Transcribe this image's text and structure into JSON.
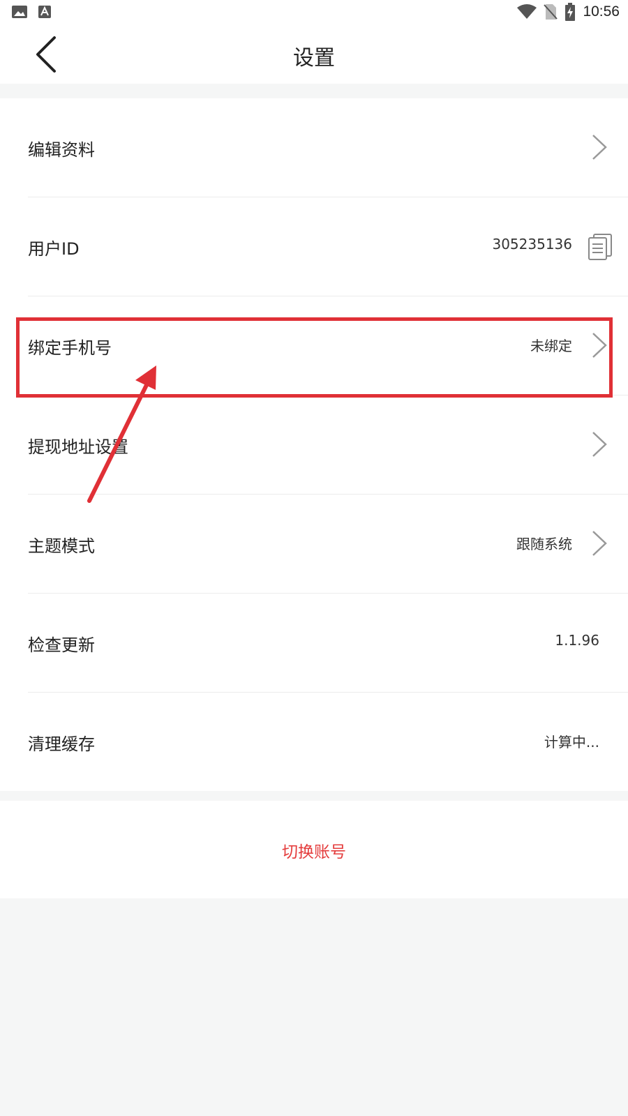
{
  "status_bar": {
    "time": "10:56"
  },
  "header": {
    "title": "设置"
  },
  "settings": {
    "edit_profile": {
      "label": "编辑资料"
    },
    "user_id": {
      "label": "用户ID",
      "value": "305235136"
    },
    "bind_phone": {
      "label": "绑定手机号",
      "value": "未绑定"
    },
    "withdraw_address": {
      "label": "提现地址设置"
    },
    "theme_mode": {
      "label": "主题模式",
      "value": "跟随系统"
    },
    "check_update": {
      "label": "检查更新",
      "value": "1.1.96"
    },
    "clear_cache": {
      "label": "清理缓存",
      "value": "计算中..."
    }
  },
  "switch_account": {
    "label": "切换账号"
  },
  "icons": {
    "status_left": [
      "image-icon",
      "font-a-icon"
    ],
    "status_right": [
      "wifi-icon",
      "no-sim-icon",
      "battery-charging-icon"
    ],
    "back": "back-arrow-icon",
    "copy": "copy-icon",
    "chevron": "chevron-right-icon"
  },
  "colors": {
    "accent_red": "#e43c3c",
    "annotation_red": "#e03036",
    "background": "#f5f6f6"
  }
}
